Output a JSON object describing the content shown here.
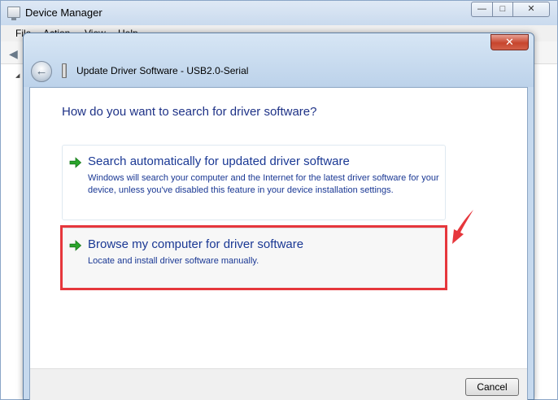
{
  "device_manager": {
    "title": "Device Manager",
    "menu": [
      "File",
      "Action",
      "View",
      "Help"
    ]
  },
  "dialog": {
    "title": "Update Driver Software - USB2.0-Serial",
    "close_glyph": "✕",
    "question": "How do you want to search for driver software?",
    "options": [
      {
        "title": "Search automatically for updated driver software",
        "description": "Windows will search your computer and the Internet for the latest driver software for your device, unless you've disabled this feature in your device installation settings."
      },
      {
        "title": "Browse my computer for driver software",
        "description": "Locate and install driver software manually."
      }
    ],
    "cancel_label": "Cancel"
  },
  "icons": {
    "option_arrow": "green-right-arrow-icon",
    "back": "back-arrow-icon",
    "device": "usb-device-icon"
  },
  "colors": {
    "link_blue": "#1a3894",
    "heading_blue": "#1e3287",
    "arrow_green": "#2aa52a",
    "highlight_red": "#e6373c"
  }
}
